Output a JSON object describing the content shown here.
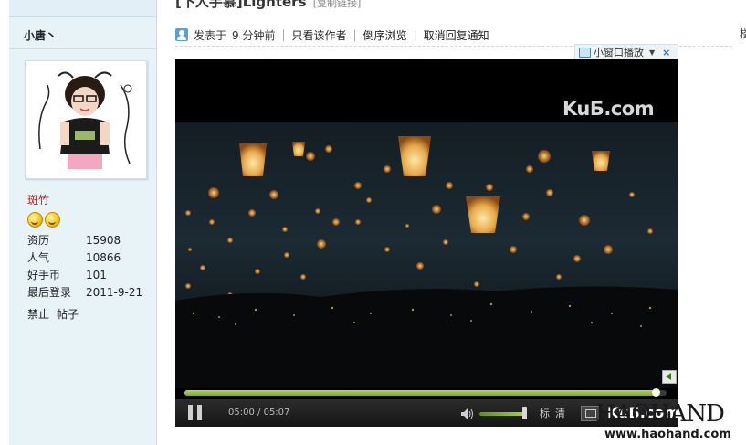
{
  "sidebar": {
    "tabs_text": "",
    "username": "小唐丶",
    "user_title": "斑竹",
    "stats": [
      {
        "label": "资历",
        "value": "15908"
      },
      {
        "label": "人气",
        "value": "10866"
      },
      {
        "label": "好手币",
        "value": "101"
      },
      {
        "label": "最后登录",
        "value": "2011-9-21"
      }
    ],
    "actions": {
      "ban": "禁止",
      "posts": "帖子"
    },
    "medal_count": 2
  },
  "post": {
    "title": "[下人手慕]Lighters",
    "title_sub": "[复制链接]",
    "posted_label": "发表于",
    "posted_time": "9 分钟前",
    "author_only": "只看该作者",
    "reverse_browse": "倒序浏览",
    "cancel_notify": "取消回复通知",
    "right_cut_char": "楼"
  },
  "mini_player": {
    "label": "小窗口播放",
    "close": "×"
  },
  "video": {
    "watermark": "KuБ.com",
    "time_current": "05:00",
    "time_total": "05:07",
    "progress": 0.98,
    "volume": 0.9,
    "quality": "标清",
    "logo": "KuБ.com"
  },
  "site": {
    "brand": "HAOHAND",
    "url": "www.haohand.com"
  },
  "colors": {
    "accent_green": "#8db83a",
    "title_red": "#b51d1d",
    "link_blue": "#3a6fb0"
  }
}
